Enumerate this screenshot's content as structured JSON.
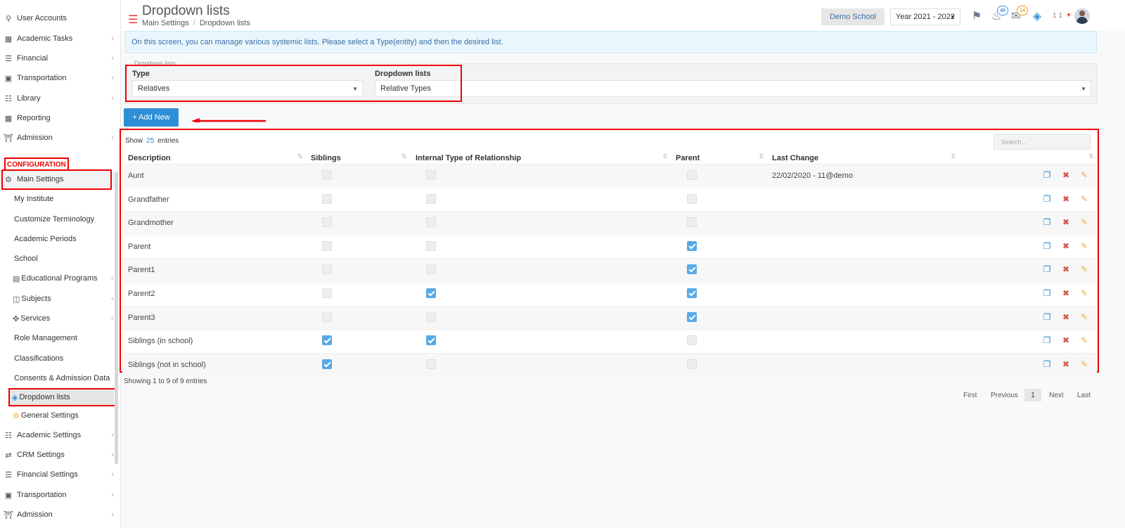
{
  "sidebar": {
    "items_top": [
      {
        "label": "User Accounts",
        "icon": "key-icon"
      },
      {
        "label": "Academic Tasks",
        "icon": "grid-icon"
      },
      {
        "label": "Financial",
        "icon": "coins-icon"
      },
      {
        "label": "Transportation",
        "icon": "bus-icon"
      },
      {
        "label": "Library",
        "icon": "books-icon"
      },
      {
        "label": "Reporting",
        "icon": "printer-icon"
      },
      {
        "label": "Admission",
        "icon": "building-icon"
      }
    ],
    "configuration_label": "CONFIGURATION",
    "main_settings": "Main Settings",
    "sub_items": [
      "My Institute",
      "Customize Terminology",
      "Academic Periods",
      "School",
      "Educational Programs",
      "Subjects",
      "Services",
      "Role Management",
      "Classifications",
      "Consents & Admission Data",
      "Dropdown lists",
      "General Settings"
    ],
    "items_bottom": [
      {
        "label": "Academic Settings",
        "icon": "sitemap-icon"
      },
      {
        "label": "CRM Settings",
        "icon": "shuffle-icon"
      },
      {
        "label": "Financial Settings",
        "icon": "coins-icon"
      },
      {
        "label": "Transportation",
        "icon": "bus-icon"
      },
      {
        "label": "Admission",
        "icon": "building-icon"
      }
    ]
  },
  "header": {
    "title": "Dropdown lists",
    "breadcrumb": [
      "Main Settings",
      "Dropdown lists"
    ],
    "school": "Demo School",
    "year": "Year 2021 - 2022",
    "notifications_count": "48",
    "messages_count": "14",
    "user": "1 1"
  },
  "info_text": "On this screen, you can manage various systemic lists. Please select a Type(entity) and then the desired list.",
  "filters": {
    "caption": "Dropdown lists",
    "type_label": "Type",
    "type_value": "Relatives",
    "list_label": "Dropdown lists",
    "list_value": "Relative Types"
  },
  "add_button": "+ Add New",
  "table": {
    "show_label": "Show",
    "entries_count": "25",
    "entries_label": "entries",
    "search_placeholder": "Search...",
    "columns": [
      "Description",
      "Siblings",
      "Internal Type of Relationship",
      "Parent",
      "Last Change"
    ],
    "rows": [
      {
        "description": "Aunt",
        "siblings": false,
        "internal": false,
        "parent": false,
        "last_change": "22/02/2020 - 11@demo"
      },
      {
        "description": "Grandfather",
        "siblings": false,
        "internal": false,
        "parent": false,
        "last_change": ""
      },
      {
        "description": "Grandmother",
        "siblings": false,
        "internal": false,
        "parent": false,
        "last_change": ""
      },
      {
        "description": "Parent",
        "siblings": false,
        "internal": false,
        "parent": true,
        "last_change": ""
      },
      {
        "description": "Parent1",
        "siblings": false,
        "internal": false,
        "parent": true,
        "last_change": ""
      },
      {
        "description": "Parent2",
        "siblings": false,
        "internal": true,
        "parent": true,
        "last_change": ""
      },
      {
        "description": "Parent3",
        "siblings": false,
        "internal": false,
        "parent": true,
        "last_change": ""
      },
      {
        "description": "Siblings (in school)",
        "siblings": true,
        "internal": true,
        "parent": false,
        "last_change": ""
      },
      {
        "description": "Siblings (not in school)",
        "siblings": true,
        "internal": false,
        "parent": false,
        "last_change": ""
      }
    ],
    "showing_text": "Showing 1 to 9 of 9 entries",
    "pagination": {
      "first": "First",
      "previous": "Previous",
      "current": "1",
      "next": "Next",
      "last": "Last"
    }
  },
  "colors": {
    "accent": "#2d8fd5",
    "highlight": "#ee0000",
    "checked": "#5aa9e6"
  }
}
